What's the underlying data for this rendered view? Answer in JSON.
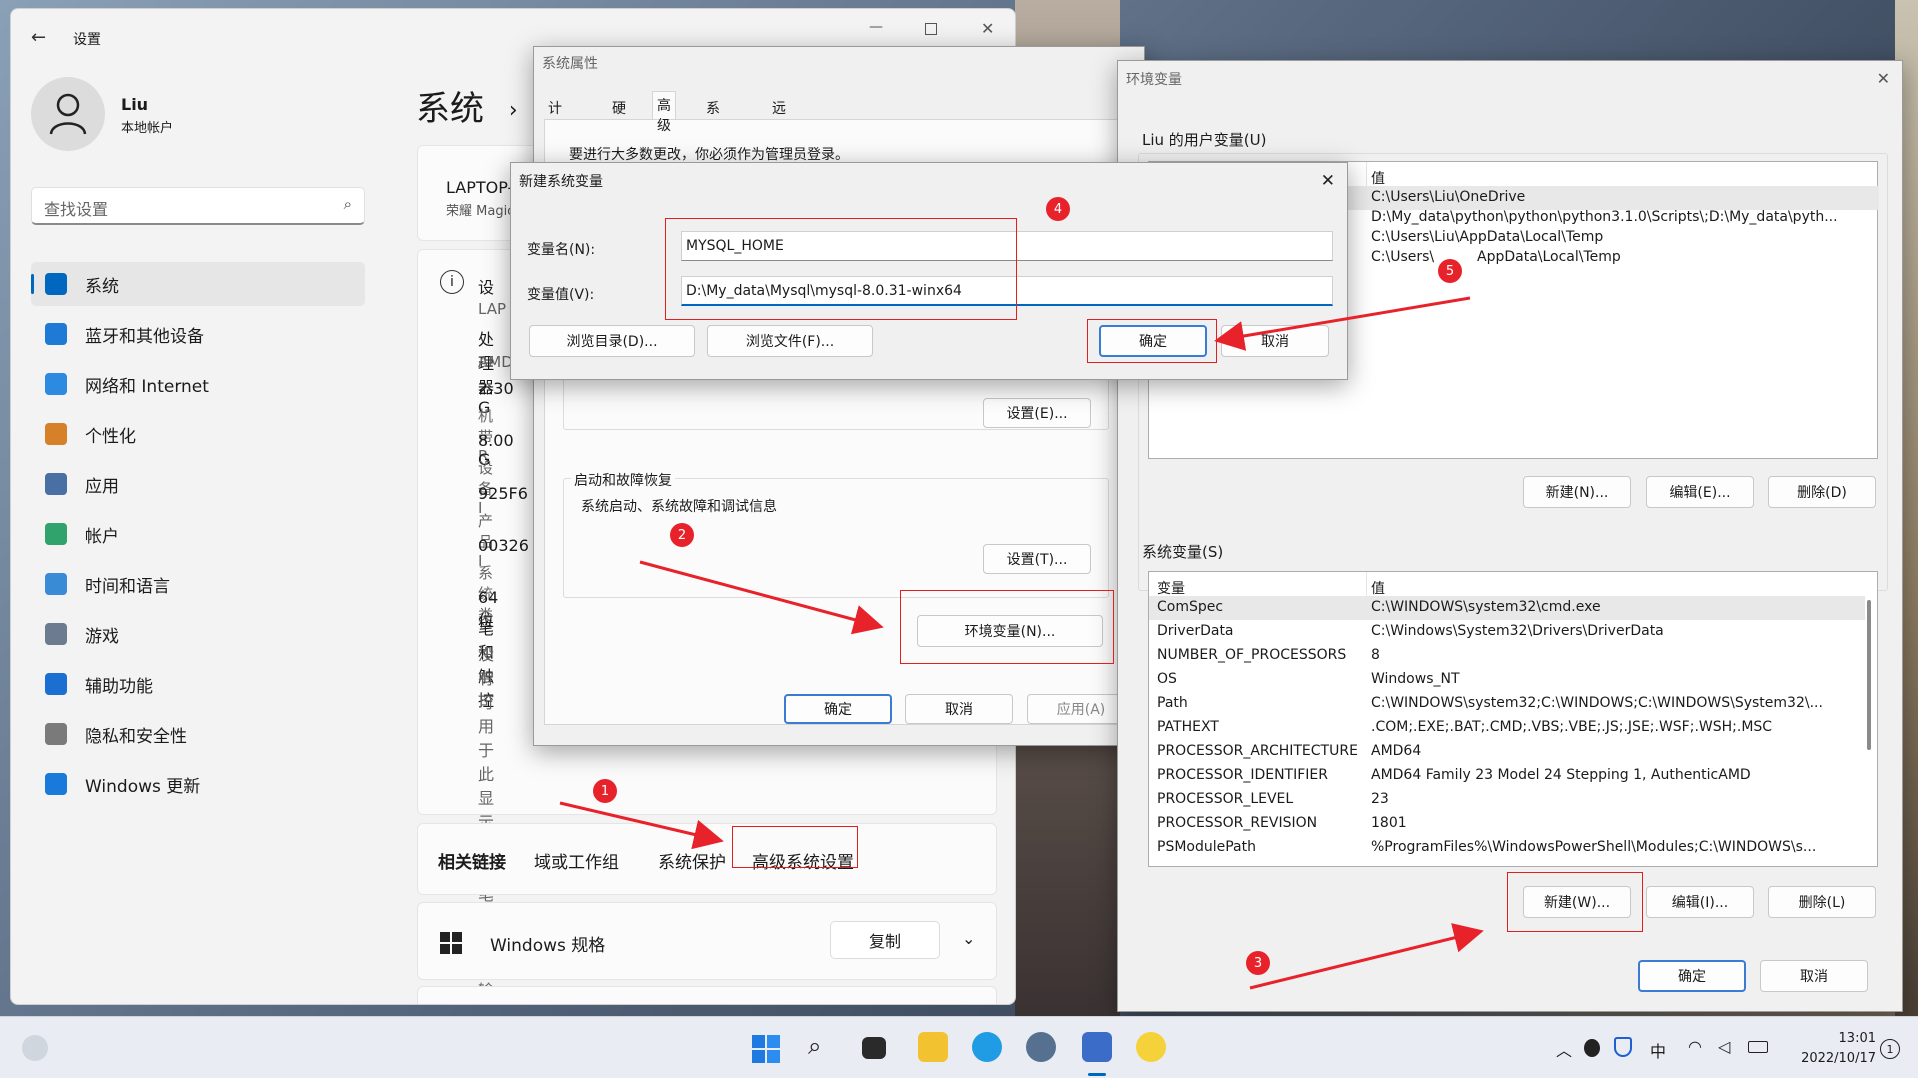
{
  "settings": {
    "title": "设置",
    "user_name": "Liu",
    "user_sub": "本地帐户",
    "search_placeholder": "查找设置",
    "breadcrumb": "系统",
    "nav": [
      {
        "label": "系统",
        "color": "#0067c0"
      },
      {
        "label": "蓝牙和其他设备",
        "color": "#1f7ad6"
      },
      {
        "label": "网络和 Internet",
        "color": "#2c8ae0"
      },
      {
        "label": "个性化",
        "color": "#d6802a"
      },
      {
        "label": "应用",
        "color": "#4a6fa5"
      },
      {
        "label": "帐户",
        "color": "#2fa36b"
      },
      {
        "label": "时间和语言",
        "color": "#3a8bd6"
      },
      {
        "label": "游戏",
        "color": "#6c7b8f"
      },
      {
        "label": "辅助功能",
        "color": "#1b6fd0"
      },
      {
        "label": "隐私和安全性",
        "color": "#7a7a7a"
      },
      {
        "label": "Windows 更新",
        "color": "#1a7ad9"
      }
    ],
    "device_name": "LAPTOP-C",
    "device_model": "荣耀 Magic",
    "spec_labels": [
      "设",
      "设",
      "LAP",
      "处理器",
      "AMD",
      "2.30 G",
      "机带 R",
      "8.00 G",
      "设备 I",
      "925F6",
      "产品 I",
      "00326",
      "系统类",
      "64 位",
      "笔和触控",
      "没有可用于此显示器的笔或触控输入"
    ],
    "related_links_label": "相关链接",
    "related_links": [
      "域或工作组",
      "系统保护",
      "高级系统设置"
    ],
    "windows_spec": "Windows 规格",
    "copy_btn": "复制"
  },
  "sysprops": {
    "title": "系统属性",
    "tabs": [
      "计算机名",
      "硬件",
      "高级",
      "系统保护",
      "远程"
    ],
    "admin_note": "要进行大多数更改，你必须作为管理员登录。",
    "settings_btn1": "设置(E)...",
    "startup_group": "启动和故障恢复",
    "startup_desc": "系统启动、系统故障和调试信息",
    "settings_btn2": "设置(T)...",
    "env_btn": "环境变量(N)...",
    "ok": "确定",
    "cancel": "取消",
    "apply": "应用(A)"
  },
  "newvar": {
    "title": "新建系统变量",
    "name_label": "变量名(N):",
    "name_value": "MYSQL_HOME",
    "value_label": "变量值(V):",
    "value_value": "D:\\My_data\\Mysql\\mysql-8.0.31-winx64",
    "browse_dir": "浏览目录(D)...",
    "browse_file": "浏览文件(F)...",
    "ok": "确定",
    "cancel": "取消"
  },
  "envvars": {
    "title": "环境变量",
    "user_group": "Liu 的用户变量(U)",
    "user_col_value": "值",
    "user_rows": [
      "C:\\Users\\Liu\\OneDrive",
      "D:\\My_data\\python\\python\\python3.1.0\\Scripts\\;D:\\My_data\\pyth...",
      "C:\\Users\\Liu\\AppData\\Local\\Temp",
      "C:\\Users\\",
      "AppData\\Local\\Temp"
    ],
    "user_new": "新建(N)...",
    "user_edit": "编辑(E)...",
    "user_delete": "删除(D)",
    "sys_group": "系统变量(S)",
    "col_var": "变量",
    "col_val": "值",
    "sys_rows": [
      {
        "name": "ComSpec",
        "value": "C:\\WINDOWS\\system32\\cmd.exe"
      },
      {
        "name": "DriverData",
        "value": "C:\\Windows\\System32\\Drivers\\DriverData"
      },
      {
        "name": "NUMBER_OF_PROCESSORS",
        "value": "8"
      },
      {
        "name": "OS",
        "value": "Windows_NT"
      },
      {
        "name": "Path",
        "value": "C:\\WINDOWS\\system32;C:\\WINDOWS;C:\\WINDOWS\\System32\\..."
      },
      {
        "name": "PATHEXT",
        "value": ".COM;.EXE;.BAT;.CMD;.VBS;.VBE;.JS;.JSE;.WSF;.WSH;.MSC"
      },
      {
        "name": "PROCESSOR_ARCHITECTURE",
        "value": "AMD64"
      },
      {
        "name": "PROCESSOR_IDENTIFIER",
        "value": "AMD64 Family 23 Model 24 Stepping 1, AuthenticAMD"
      },
      {
        "name": "PROCESSOR_LEVEL",
        "value": "23"
      },
      {
        "name": "PROCESSOR_REVISION",
        "value": "1801"
      },
      {
        "name": "PSModulePath",
        "value": "%ProgramFiles%\\WindowsPowerShell\\Modules;C:\\WINDOWS\\s..."
      }
    ],
    "sys_new": "新建(W)...",
    "sys_edit": "编辑(I)...",
    "sys_delete": "删除(L)",
    "ok": "确定",
    "cancel": "取消"
  },
  "badges": [
    "1",
    "2",
    "3",
    "4",
    "5"
  ],
  "taskbar": {
    "time": "13:01",
    "date": "2022/10/17",
    "ime": "中",
    "notif": "1"
  }
}
